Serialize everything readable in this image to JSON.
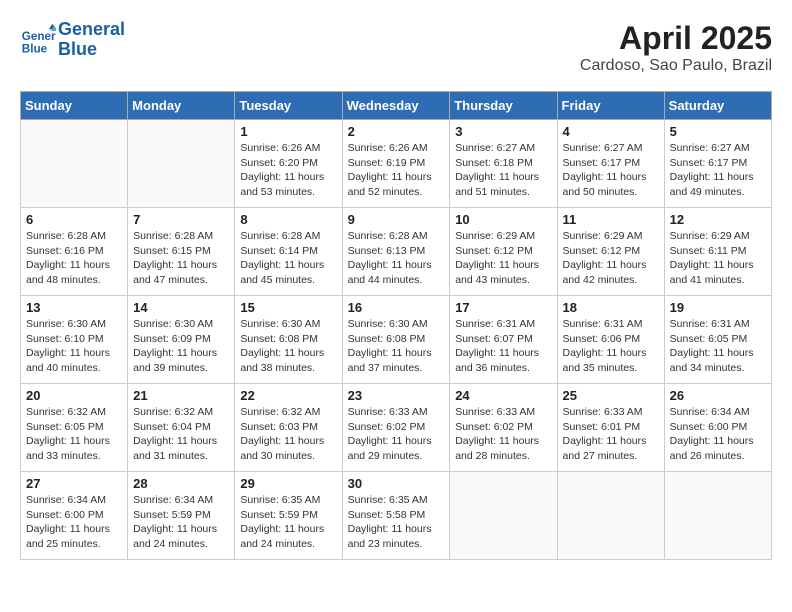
{
  "header": {
    "logo_line1": "General",
    "logo_line2": "Blue",
    "month_title": "April 2025",
    "location": "Cardoso, Sao Paulo, Brazil"
  },
  "weekdays": [
    "Sunday",
    "Monday",
    "Tuesday",
    "Wednesday",
    "Thursday",
    "Friday",
    "Saturday"
  ],
  "weeks": [
    [
      {
        "day": "",
        "detail": ""
      },
      {
        "day": "",
        "detail": ""
      },
      {
        "day": "1",
        "detail": "Sunrise: 6:26 AM\nSunset: 6:20 PM\nDaylight: 11 hours and 53 minutes."
      },
      {
        "day": "2",
        "detail": "Sunrise: 6:26 AM\nSunset: 6:19 PM\nDaylight: 11 hours and 52 minutes."
      },
      {
        "day": "3",
        "detail": "Sunrise: 6:27 AM\nSunset: 6:18 PM\nDaylight: 11 hours and 51 minutes."
      },
      {
        "day": "4",
        "detail": "Sunrise: 6:27 AM\nSunset: 6:17 PM\nDaylight: 11 hours and 50 minutes."
      },
      {
        "day": "5",
        "detail": "Sunrise: 6:27 AM\nSunset: 6:17 PM\nDaylight: 11 hours and 49 minutes."
      }
    ],
    [
      {
        "day": "6",
        "detail": "Sunrise: 6:28 AM\nSunset: 6:16 PM\nDaylight: 11 hours and 48 minutes."
      },
      {
        "day": "7",
        "detail": "Sunrise: 6:28 AM\nSunset: 6:15 PM\nDaylight: 11 hours and 47 minutes."
      },
      {
        "day": "8",
        "detail": "Sunrise: 6:28 AM\nSunset: 6:14 PM\nDaylight: 11 hours and 45 minutes."
      },
      {
        "day": "9",
        "detail": "Sunrise: 6:28 AM\nSunset: 6:13 PM\nDaylight: 11 hours and 44 minutes."
      },
      {
        "day": "10",
        "detail": "Sunrise: 6:29 AM\nSunset: 6:12 PM\nDaylight: 11 hours and 43 minutes."
      },
      {
        "day": "11",
        "detail": "Sunrise: 6:29 AM\nSunset: 6:12 PM\nDaylight: 11 hours and 42 minutes."
      },
      {
        "day": "12",
        "detail": "Sunrise: 6:29 AM\nSunset: 6:11 PM\nDaylight: 11 hours and 41 minutes."
      }
    ],
    [
      {
        "day": "13",
        "detail": "Sunrise: 6:30 AM\nSunset: 6:10 PM\nDaylight: 11 hours and 40 minutes."
      },
      {
        "day": "14",
        "detail": "Sunrise: 6:30 AM\nSunset: 6:09 PM\nDaylight: 11 hours and 39 minutes."
      },
      {
        "day": "15",
        "detail": "Sunrise: 6:30 AM\nSunset: 6:08 PM\nDaylight: 11 hours and 38 minutes."
      },
      {
        "day": "16",
        "detail": "Sunrise: 6:30 AM\nSunset: 6:08 PM\nDaylight: 11 hours and 37 minutes."
      },
      {
        "day": "17",
        "detail": "Sunrise: 6:31 AM\nSunset: 6:07 PM\nDaylight: 11 hours and 36 minutes."
      },
      {
        "day": "18",
        "detail": "Sunrise: 6:31 AM\nSunset: 6:06 PM\nDaylight: 11 hours and 35 minutes."
      },
      {
        "day": "19",
        "detail": "Sunrise: 6:31 AM\nSunset: 6:05 PM\nDaylight: 11 hours and 34 minutes."
      }
    ],
    [
      {
        "day": "20",
        "detail": "Sunrise: 6:32 AM\nSunset: 6:05 PM\nDaylight: 11 hours and 33 minutes."
      },
      {
        "day": "21",
        "detail": "Sunrise: 6:32 AM\nSunset: 6:04 PM\nDaylight: 11 hours and 31 minutes."
      },
      {
        "day": "22",
        "detail": "Sunrise: 6:32 AM\nSunset: 6:03 PM\nDaylight: 11 hours and 30 minutes."
      },
      {
        "day": "23",
        "detail": "Sunrise: 6:33 AM\nSunset: 6:02 PM\nDaylight: 11 hours and 29 minutes."
      },
      {
        "day": "24",
        "detail": "Sunrise: 6:33 AM\nSunset: 6:02 PM\nDaylight: 11 hours and 28 minutes."
      },
      {
        "day": "25",
        "detail": "Sunrise: 6:33 AM\nSunset: 6:01 PM\nDaylight: 11 hours and 27 minutes."
      },
      {
        "day": "26",
        "detail": "Sunrise: 6:34 AM\nSunset: 6:00 PM\nDaylight: 11 hours and 26 minutes."
      }
    ],
    [
      {
        "day": "27",
        "detail": "Sunrise: 6:34 AM\nSunset: 6:00 PM\nDaylight: 11 hours and 25 minutes."
      },
      {
        "day": "28",
        "detail": "Sunrise: 6:34 AM\nSunset: 5:59 PM\nDaylight: 11 hours and 24 minutes."
      },
      {
        "day": "29",
        "detail": "Sunrise: 6:35 AM\nSunset: 5:59 PM\nDaylight: 11 hours and 24 minutes."
      },
      {
        "day": "30",
        "detail": "Sunrise: 6:35 AM\nSunset: 5:58 PM\nDaylight: 11 hours and 23 minutes."
      },
      {
        "day": "",
        "detail": ""
      },
      {
        "day": "",
        "detail": ""
      },
      {
        "day": "",
        "detail": ""
      }
    ]
  ]
}
